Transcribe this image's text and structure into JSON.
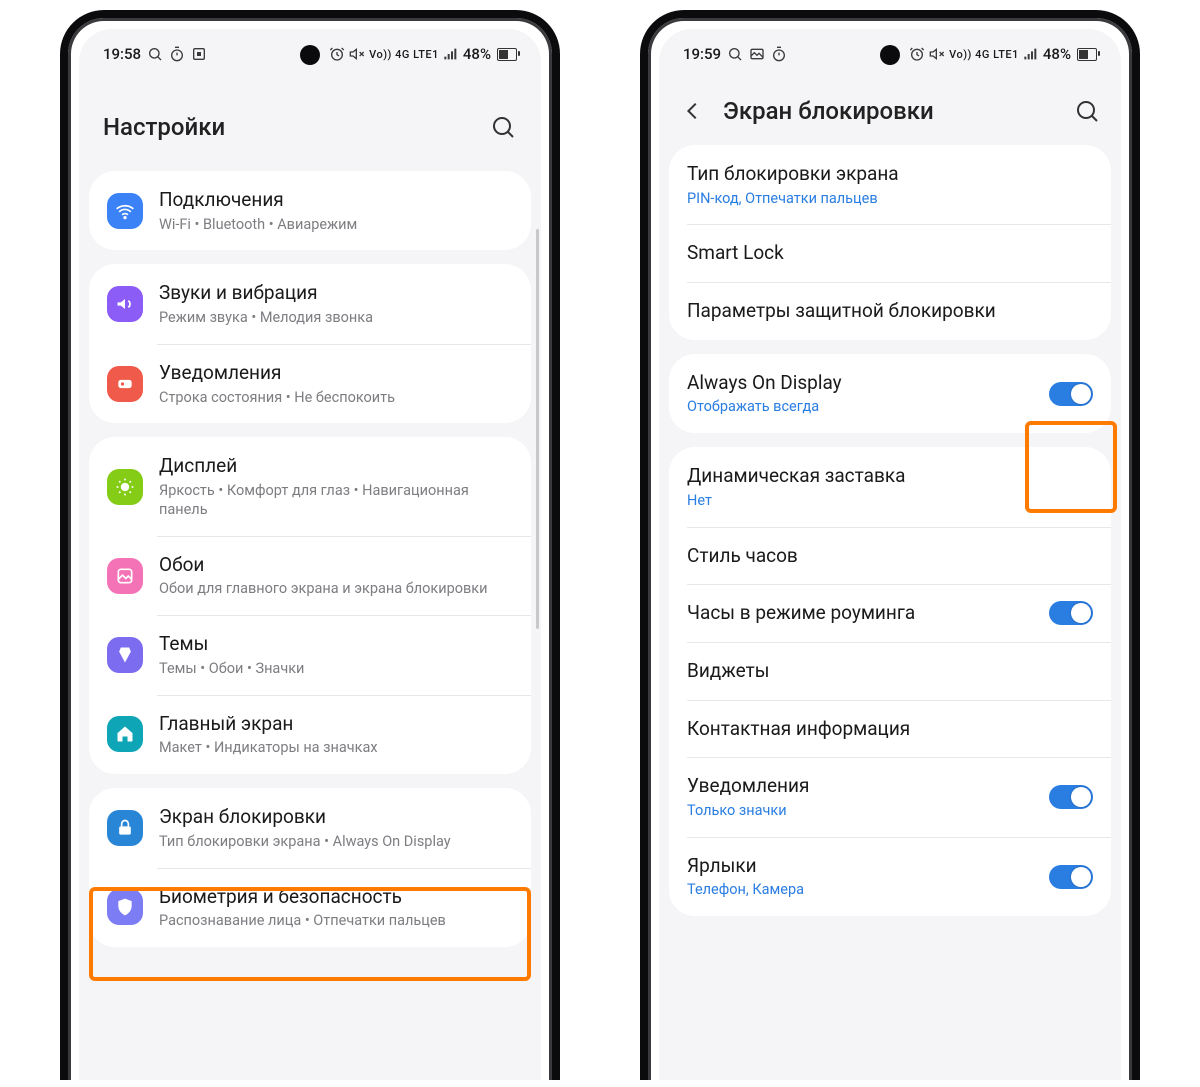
{
  "left": {
    "status": {
      "time": "19:58",
      "network": "Vo)) 4G LTE1",
      "battery": "48%"
    },
    "header": {
      "title": "Настройки"
    },
    "groups": [
      [
        {
          "icon": "wifi",
          "title": "Подключения",
          "sub": "Wi-Fi  •  Bluetooth  •  Авиарежим"
        }
      ],
      [
        {
          "icon": "sound",
          "title": "Звуки и вибрация",
          "sub": "Режим звука  •  Мелодия звонка"
        },
        {
          "icon": "notif",
          "title": "Уведомления",
          "sub": "Строка состояния  •  Не беспокоить"
        }
      ],
      [
        {
          "icon": "display",
          "title": "Дисплей",
          "sub": "Яркость  •  Комфорт для глаз  •  Навигационная панель"
        },
        {
          "icon": "wall",
          "title": "Обои",
          "sub": "Обои для главного экрана и экрана блокировки"
        },
        {
          "icon": "themes",
          "title": "Темы",
          "sub": "Темы  •  Обои  •  Значки"
        },
        {
          "icon": "home",
          "title": "Главный экран",
          "sub": "Макет  •  Индикаторы на значках"
        }
      ],
      [
        {
          "icon": "lock",
          "title": "Экран блокировки",
          "sub": "Тип блокировки экрана  •  Always On Display"
        },
        {
          "icon": "bio",
          "title": "Биометрия и безопасность",
          "sub": "Распознавание лица  •  Отпечатки пальцев"
        }
      ]
    ]
  },
  "right": {
    "status": {
      "time": "19:59",
      "network": "Vo)) 4G LTE1",
      "battery": "48%"
    },
    "header": {
      "title": "Экран блокировки"
    },
    "groups": [
      [
        {
          "title": "Тип блокировки экрана",
          "sub": "PIN-код, Отпечатки пальцев",
          "sublink": true
        },
        {
          "title": "Smart Lock"
        },
        {
          "title": "Параметры защитной блокировки"
        }
      ],
      [
        {
          "title": "Always On Display",
          "sub": "Отображать всегда",
          "sublink": true,
          "toggle": true
        }
      ],
      [
        {
          "title": "Динамическая заставка",
          "sub": "Нет",
          "sublink": true
        },
        {
          "title": "Стиль часов"
        },
        {
          "title": "Часы в режиме роуминга",
          "toggle": true
        },
        {
          "title": "Виджеты"
        },
        {
          "title": "Контактная информация"
        },
        {
          "title": "Уведомления",
          "sub": "Только значки",
          "sublink": true,
          "toggle": true
        },
        {
          "title": "Ярлыки",
          "sub": "Телефон, Камера",
          "sublink": true,
          "toggle": true
        }
      ]
    ]
  }
}
